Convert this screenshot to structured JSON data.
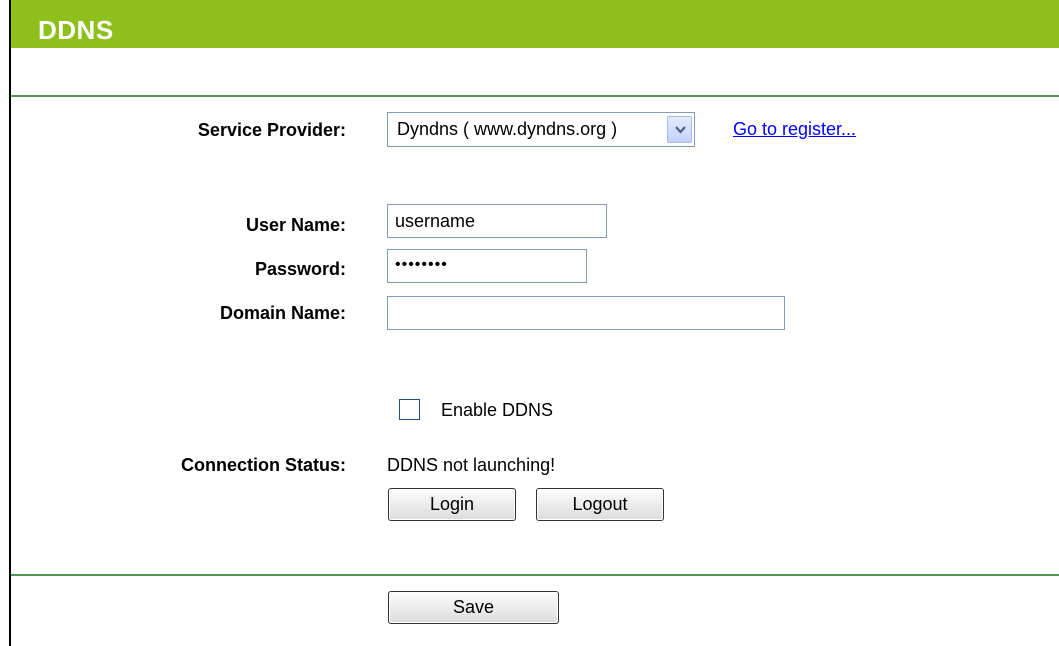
{
  "header": {
    "title": "DDNS"
  },
  "form": {
    "service_provider": {
      "label": "Service Provider:",
      "selected": "Dyndns ( www.dyndns.org )",
      "register_link": "Go to register..."
    },
    "username": {
      "label": "User Name:",
      "value": "username"
    },
    "password": {
      "label": "Password:",
      "value": "••••••••"
    },
    "domain_name": {
      "label": "Domain Name:",
      "value": ""
    },
    "enable_ddns": {
      "label": "Enable DDNS",
      "checked": false
    },
    "connection_status": {
      "label": "Connection Status:",
      "value": "DDNS not launching!"
    }
  },
  "buttons": {
    "login": "Login",
    "logout": "Logout",
    "save": "Save"
  },
  "colors": {
    "header_bg": "#8dc01b",
    "divider": "#4f9a5a",
    "link": "#0000ff"
  }
}
